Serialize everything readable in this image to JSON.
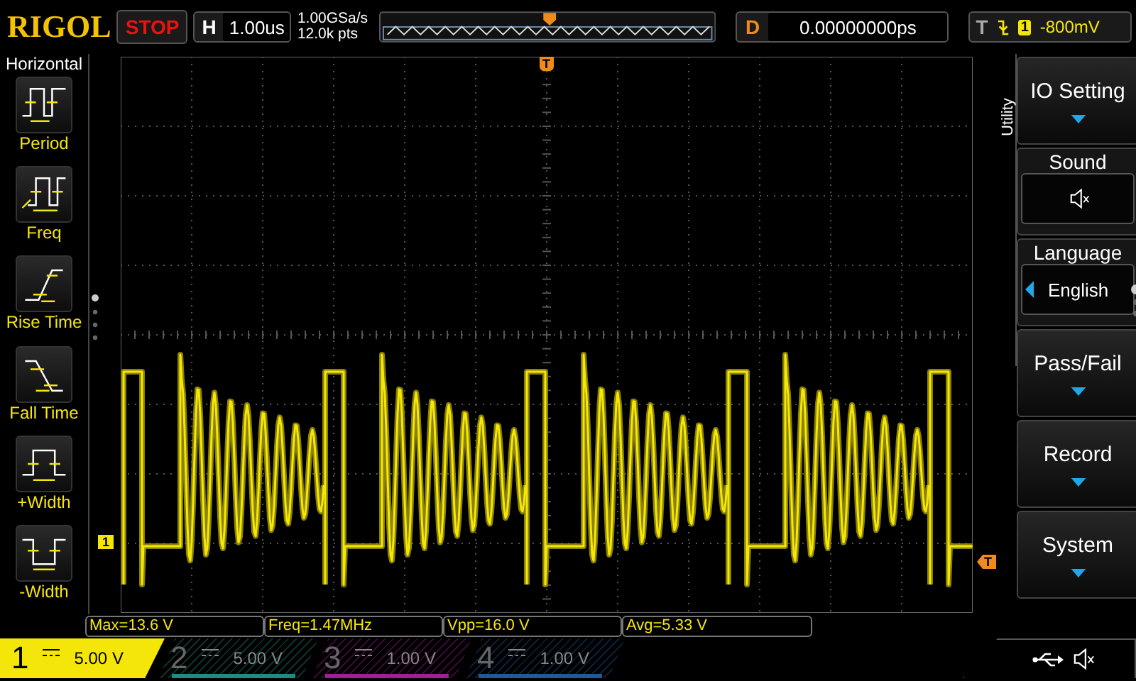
{
  "brand": "RIGOL",
  "run_state": "STOP",
  "timebase": {
    "label": "H",
    "value": "1.00us"
  },
  "acquisition": {
    "sample_rate": "1.00GSa/s",
    "memory_depth": "12.0k pts"
  },
  "delay": {
    "label": "D",
    "value": "0.00000000ps"
  },
  "trigger": {
    "label": "T",
    "channel": "1",
    "level": "-800mV",
    "marker": "T",
    "level_marker": "T"
  },
  "left_menu": {
    "title": "Horizontal",
    "items": [
      {
        "label": "Period",
        "kind": "period"
      },
      {
        "label": "Freq",
        "kind": "freq"
      },
      {
        "label": "Rise Time",
        "kind": "rise"
      },
      {
        "label": "Fall Time",
        "kind": "fall"
      },
      {
        "label": "+Width",
        "kind": "pwidth"
      },
      {
        "label": "-Width",
        "kind": "nwidth"
      }
    ]
  },
  "right_menu": {
    "title": "Utility",
    "items": [
      {
        "label": "IO Setting",
        "kind": "submenu"
      },
      {
        "label": "Sound",
        "kind": "sound",
        "muted": true
      },
      {
        "label": "Language",
        "kind": "choice",
        "value": "English"
      },
      {
        "label": "Pass/Fail",
        "kind": "submenu"
      },
      {
        "label": "Record",
        "kind": "submenu"
      },
      {
        "label": "System",
        "kind": "submenu"
      }
    ]
  },
  "ground_marker": "1",
  "measurements": [
    "Max=13.6 V",
    "Freq=1.47MHz",
    "Vpp=16.0 V",
    "Avg=5.33 V"
  ],
  "channels": [
    {
      "number": "1",
      "scale": "5.00 V",
      "selected": true,
      "color": "#f5e60a"
    },
    {
      "number": "2",
      "scale": "5.00 V",
      "selected": false,
      "color": "#1e8c82"
    },
    {
      "number": "3",
      "scale": "1.00 V",
      "selected": false,
      "color": "#a01e96"
    },
    {
      "number": "4",
      "scale": "1.00 V",
      "selected": false,
      "color": "#1e5a96"
    }
  ]
}
